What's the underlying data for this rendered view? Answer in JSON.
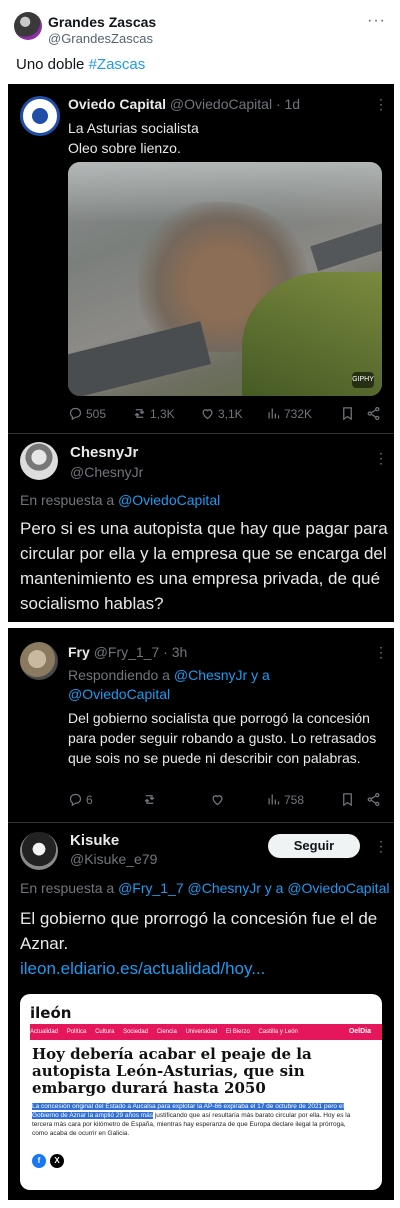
{
  "outer_tweet": {
    "name": "Grandes Zascas",
    "handle": "@GrandesZascas",
    "more": "···",
    "text_plain": "Uno doble ",
    "hashtag": "#Zascas"
  },
  "oviedo_tweet": {
    "name": "Oviedo Capital",
    "meta": "@OviedoCapital · 1d",
    "line1": "La Asturias socialista",
    "line2": "Oleo sobre lienzo.",
    "photo_badge": "GIPHY",
    "replies": "505",
    "retweets": "1,3K",
    "likes": "3,1K",
    "views": "732K"
  },
  "chesny_reply": {
    "name": "ChesnyJr",
    "handle": "@ChesnyJr",
    "reply_prefix": "En respuesta a ",
    "reply_target": "@OviedoCapital",
    "body": "Pero si es una autopista que hay que pagar para circular por ella y la empresa que se encarga del mantenimiento es una empresa privada,  de qué socialismo hablas?"
  },
  "fry_tweet": {
    "name": "Fry",
    "meta": "@Fry_1_7 · 3h",
    "reply_prefix": "Respondiendo a ",
    "reply_targets": "@ChesnyJr y a",
    "reply_targets2": "@OviedoCapital",
    "body": "Del gobierno socialista que porrogó la concesión para poder seguir robando a gusto. Lo retrasados que sois no se puede ni describir con palabras.",
    "replies": "6",
    "retweets": "",
    "likes": "",
    "views": "758"
  },
  "kisuke_reply": {
    "name": "Kisuke",
    "handle": "@Kisuke_e79",
    "follow_label": "Seguir",
    "reply_prefix": "En respuesta a ",
    "reply_targets": "@Fry_1_7 @ChesnyJr y a @OviedoCapital",
    "body": "El gobierno que prorrogó la concesión fue el de Aznar.",
    "link": "ileon.eldiario.es/actualidad/hoy..."
  },
  "article_card": {
    "logo": "ileón",
    "nav": [
      "Actualidad",
      "Política",
      "Cultura",
      "Sociedad",
      "Ciencia",
      "Universidad",
      "El Bierzo",
      "Castilla y León"
    ],
    "nav_right": "OelDia",
    "headline": "Hoy debería acabar el peaje de la autopista León-Asturias, que sin embargo durará hasta 2050",
    "summary_highlight": "La concesión original del Estado a Aucalsa para explotar la AP-66 expiraba el 17 de octubre de 2021 pero el Gobierno de Aznar la amplió 29 años más",
    "summary_rest": " justificando que así resultaría más barato circular por ella. Hoy es la tercera más cara por kilómetro de España, mientras hay esperanza de que Europa declare ilegal la prórroga, como acaba de ocurrir en Galicia."
  },
  "colors": {
    "accent": "#1d9bf0",
    "dark_bg": "#000000",
    "card_nav": "#e6165c"
  }
}
